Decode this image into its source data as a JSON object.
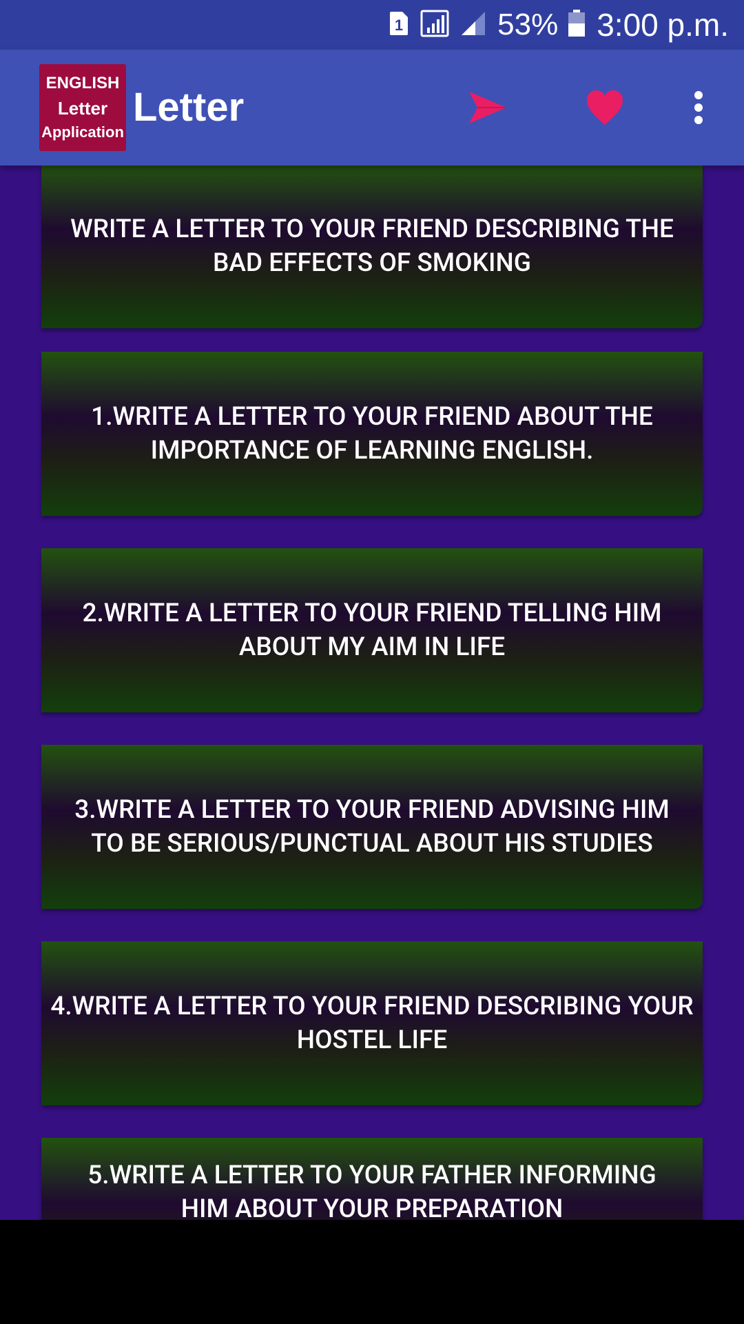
{
  "status_bar": {
    "sim_label": "1",
    "battery_percent": "53%",
    "time": "3:00 p.m."
  },
  "app_bar": {
    "logo": {
      "line1": "ENGLISH",
      "line2": "Letter",
      "line3": "Application"
    },
    "title": "Letter",
    "icons": {
      "send": "send-icon",
      "favorite": "heart-icon",
      "more": "more-vert-icon"
    },
    "colors": {
      "status_bar": "#303F9F",
      "app_bar": "#3F51B5",
      "accent": "#E91E63",
      "logo_background": "#9E0B3E",
      "list_background": "#361082"
    }
  },
  "letters": [
    {
      "title": "WRITE A LETTER TO YOUR FRIEND DESCRIBING THE BAD EFFECTS OF SMOKING"
    },
    {
      "title": "1.WRITE A LETTER TO YOUR FRIEND ABOUT THE IMPORTANCE OF LEARNING ENGLISH."
    },
    {
      "title": "2.WRITE A LETTER TO YOUR FRIEND TELLING HIM ABOUT MY AIM IN LIFE"
    },
    {
      "title": "3.WRITE A LETTER TO YOUR FRIEND ADVISING HIM TO BE SERIOUS/PUNCTUAL ABOUT HIS STUDIES"
    },
    {
      "title": "4.WRITE A LETTER TO YOUR FRIEND DESCRIBING YOUR HOSTEL LIFE"
    },
    {
      "title": "5.WRITE A LETTER TO YOUR FATHER INFORMING HIM ABOUT YOUR PREPARATION"
    }
  ]
}
